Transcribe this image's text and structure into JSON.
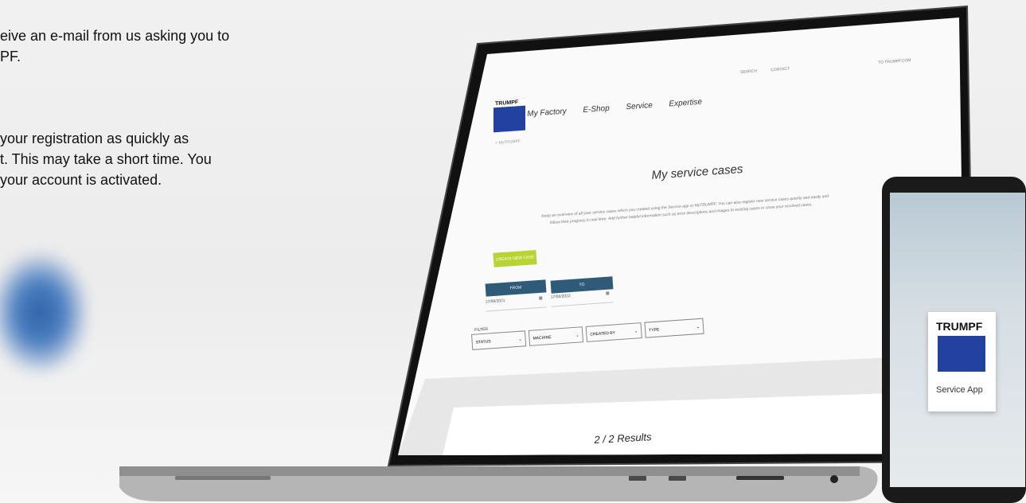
{
  "intro": {
    "line1": "eive an e-mail from us asking you to",
    "line2": "PF.",
    "line3": "your registration as quickly as",
    "line4": "t. This may take a short time. You",
    "line5": "your account is activated."
  },
  "laptop_screen": {
    "brand": "TRUMPF",
    "nav": [
      "My Factory",
      "E-Shop",
      "Service",
      "Expertise"
    ],
    "top_links": [
      "SEARCH",
      "CONTACT",
      "TO TRUMPF.COM"
    ],
    "back_link": "< MyTRUMPF",
    "title": "My service cases",
    "description_line1": "Keep an overview of all your service cases which you created using the Service app or MyTRUMPF. You can also register new service cases quickly and easily and",
    "description_line2": "follow their progress in real time. Add further helpful information such as error descriptions and images to existing cases or close your resolved cases.",
    "create_button": "CREATE NEW CASE",
    "from_label": "FROM",
    "to_label": "TO",
    "from_value": "17/08/2021",
    "to_value": "17/08/2022",
    "filter_label": "FILTER",
    "filters": [
      "STATUS",
      "MACHINE",
      "CREATED BY",
      "TYPE"
    ],
    "results": "2 / 2 Results"
  },
  "phone": {
    "logo": "TRUMPF",
    "app_name": "Service App"
  },
  "colors": {
    "trumpf_blue": "#2241a0",
    "accent_green": "#b8d432",
    "dark_teal": "#2f5a78"
  }
}
